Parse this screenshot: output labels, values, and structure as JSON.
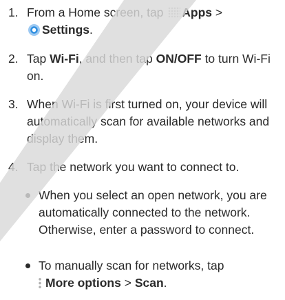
{
  "steps": [
    {
      "number": "1.",
      "pre": "From a Home screen, tap ",
      "apps_label": "Apps",
      "sep": " > ",
      "settings_label": "Settings",
      "end": "."
    },
    {
      "number": "2.",
      "pre": "Tap ",
      "wifi_label": "Wi-Fi",
      "mid": ", and then tap ",
      "onoff_label": "ON/OFF",
      "post": " to turn Wi-Fi on."
    },
    {
      "number": "3.",
      "text": "When Wi-Fi is first turned on, your device will automatically scan for available networks and display them."
    },
    {
      "number": "4.",
      "text": "Tap the network you want to connect to."
    }
  ],
  "bullets": [
    {
      "text": "When you select an open network, you are automatically connected to the network. Otherwise, enter a password to connect."
    },
    {
      "pre": "To manually scan for networks, tap ",
      "more_label": "More options",
      "sep": " > ",
      "scan_label": "Scan",
      "end": "."
    }
  ],
  "icons": {
    "apps": "apps-grid-icon",
    "settings": "settings-gear-icon",
    "more_options": "more-options-icon"
  },
  "colors": {
    "text": "#2a2a2a",
    "settings_icon": "#2f8fe0",
    "watermark": "#d9d9d9"
  }
}
